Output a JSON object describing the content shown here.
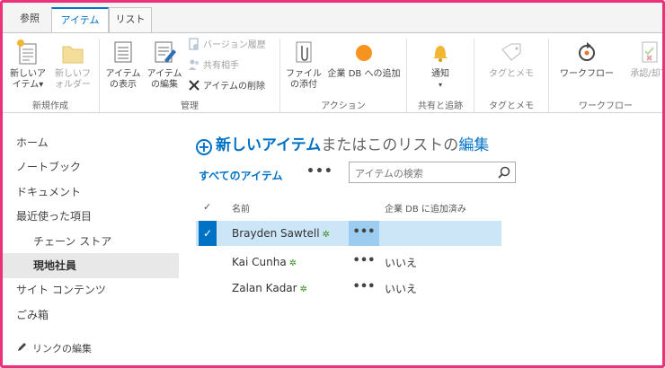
{
  "colors": {
    "accent": "#0072c6",
    "frame": "#e8327a",
    "selected_row": "#cde6f7"
  },
  "tabs": [
    {
      "label": "参照"
    },
    {
      "label": "アイテム"
    },
    {
      "label": "リスト"
    }
  ],
  "ribbon": {
    "groups": {
      "new": {
        "label": "新規作成",
        "new_item": {
          "line1": "新しいア",
          "line2": "イテム▾"
        },
        "new_folder": {
          "line1": "新しいフ",
          "line2": "ォルダー"
        }
      },
      "manage": {
        "label": "管理",
        "view_item": {
          "line1": "アイテム",
          "line2": "の表示"
        },
        "edit_item": {
          "line1": "アイテム",
          "line2": "の編集"
        },
        "version_history": "バージョン履歴",
        "shared_with": "共有相手",
        "delete_item": "アイテムの削除"
      },
      "actions": {
        "label": "アクション",
        "attach_file": {
          "line1": "ファイル",
          "line2": "の添付"
        },
        "add_to_db": "企業 DB への追加"
      },
      "share_track": {
        "label": "共有と追跡",
        "alert": "通知"
      },
      "tags": {
        "label": "タグとメモ",
        "tags_notes": "タグとメモ"
      },
      "workflow": {
        "label": "ワークフロー",
        "workflows": "ワークフロー",
        "approve_reject": "承認/却下"
      }
    }
  },
  "nav": {
    "items": [
      {
        "label": "ホーム"
      },
      {
        "label": "ノートブック"
      },
      {
        "label": "ドキュメント"
      },
      {
        "label": "最近使った項目"
      },
      {
        "label": "チェーン ストア"
      },
      {
        "label": "現地社員"
      },
      {
        "label": "サイト コンテンツ"
      },
      {
        "label": "ごみ箱"
      }
    ],
    "edit_links": "リンクの編集"
  },
  "main": {
    "new_item_link": "新しいアイテム",
    "new_item_middle": "またはこのリストの",
    "edit_link": "編集",
    "view_name": "すべてのアイテム",
    "view_more": "•••",
    "search_placeholder": "アイテムの検索",
    "columns": {
      "check": "✓",
      "name": "名前",
      "added": "企業 DB に追加済み"
    },
    "rows": [
      {
        "name": "Brayden Sawtell",
        "new_badge": "✲",
        "menu": "•••",
        "added": ""
      },
      {
        "name": "Kai Cunha",
        "new_badge": "✲",
        "menu": "•••",
        "added": "いいえ"
      },
      {
        "name": "Zalan Kadar",
        "new_badge": "✲",
        "menu": "•••",
        "added": "いいえ"
      }
    ]
  }
}
